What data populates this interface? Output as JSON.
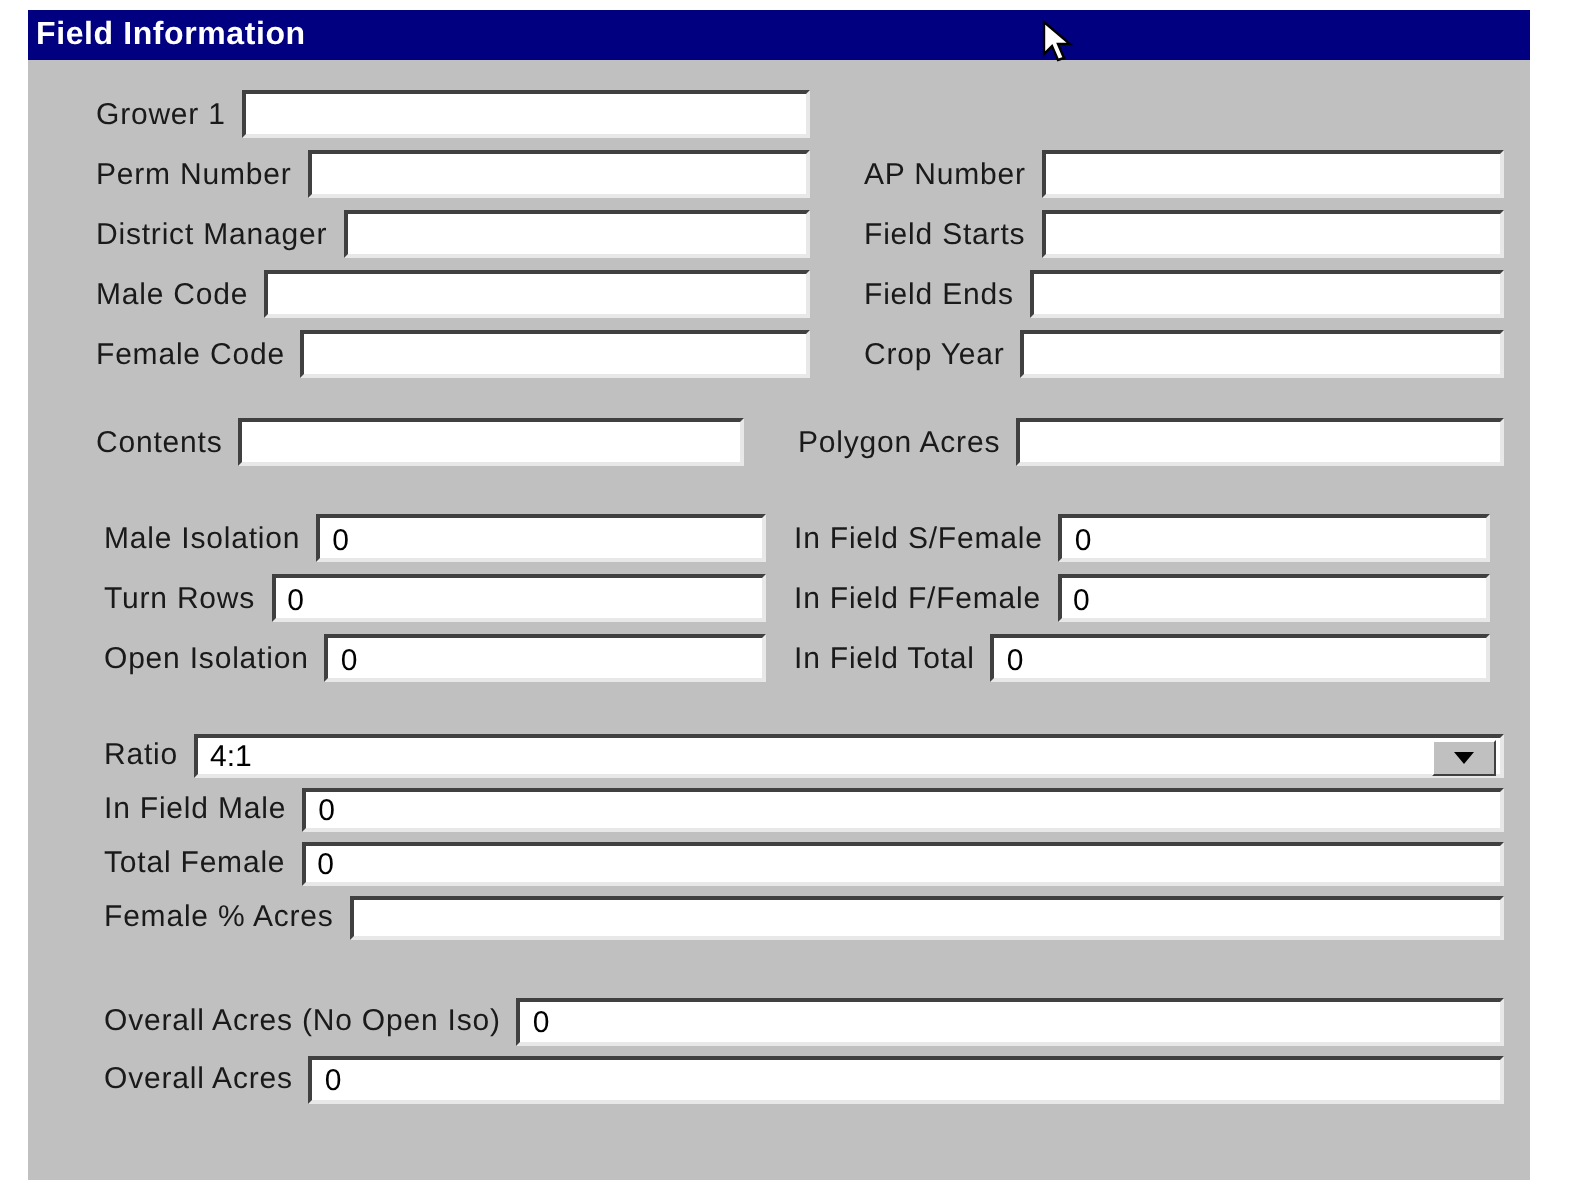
{
  "window": {
    "title": "Field Information"
  },
  "sections": [
    {
      "rows": [
        [
          {
            "label": "Grower 1",
            "kind": "text"
          },
          null
        ],
        [
          {
            "label": "Perm Number",
            "kind": "text"
          },
          {
            "label": "AP Number",
            "kind": "text"
          }
        ],
        [
          {
            "label": "District Manager",
            "kind": "text"
          },
          {
            "label": "Field Starts",
            "kind": "text"
          }
        ],
        [
          {
            "label": "Male Code",
            "kind": "text"
          },
          {
            "label": "Field Ends",
            "kind": "text"
          }
        ],
        [
          {
            "label": "Female Code",
            "kind": "text"
          },
          {
            "label": "Crop Year",
            "kind": "text"
          }
        ]
      ]
    },
    {
      "rows": [
        [
          {
            "label": "Contents",
            "kind": "text"
          },
          {
            "label": "Polygon Acres",
            "kind": "text"
          }
        ]
      ]
    },
    {
      "rows": [
        [
          {
            "label": "Male Isolation",
            "value": "0",
            "kind": "text"
          },
          {
            "label": "In Field S/Female",
            "value": "0",
            "kind": "text"
          }
        ],
        [
          {
            "label": "Turn Rows",
            "value": "0",
            "kind": "text"
          },
          {
            "label": "In Field F/Female",
            "value": "0",
            "kind": "text"
          }
        ],
        [
          {
            "label": "Open Isolation",
            "value": "0",
            "kind": "text"
          },
          {
            "label": "In Field Total",
            "value": "0",
            "kind": "text"
          }
        ]
      ]
    },
    {
      "rows": [
        [
          {
            "label": "Ratio",
            "value": "4:1",
            "kind": "dropdown"
          }
        ],
        [
          {
            "label": "In Field Male",
            "value": "0",
            "kind": "text"
          }
        ],
        [
          {
            "label": "Total Female",
            "value": "0",
            "kind": "text"
          }
        ],
        [
          {
            "label": "Female % Acres",
            "kind": "text"
          }
        ]
      ]
    },
    {
      "rows": [
        [
          {
            "label": "Overall Acres (No Open Iso)",
            "value": "0",
            "kind": "text"
          }
        ],
        [
          {
            "label": "Overall Acres",
            "value": "0",
            "kind": "text"
          }
        ]
      ]
    }
  ]
}
